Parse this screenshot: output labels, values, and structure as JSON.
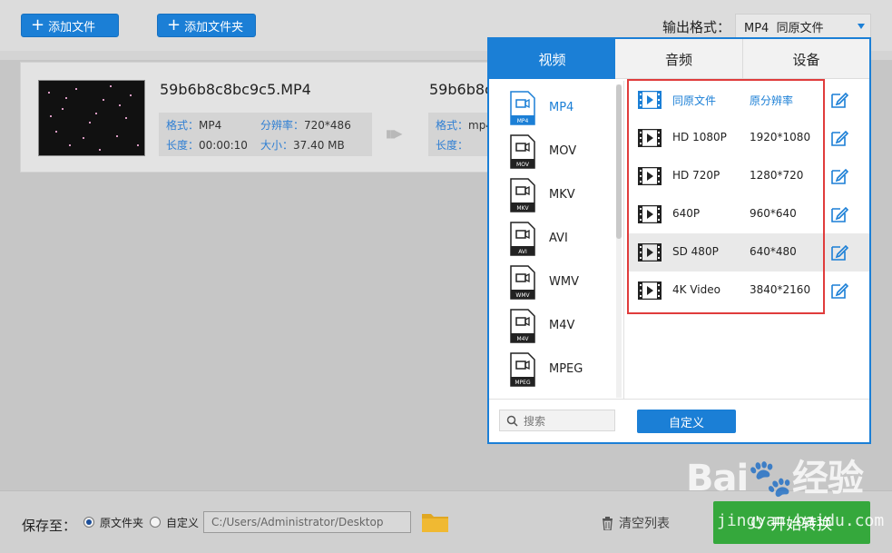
{
  "toolbar": {
    "add_file": "添加文件",
    "add_folder": "添加文件夹",
    "output_format_label": "输出格式：",
    "output_format_value": "MP4  同原文件"
  },
  "file": {
    "source_name": "59b6b8c8bc9c5.MP4",
    "target_name": "59b6b8c",
    "format_label": "格式：",
    "format_value": "MP4",
    "resolution_label": "分辨率：",
    "resolution_value": "720*486",
    "duration_label": "长度：",
    "duration_value": "00:00:10",
    "size_label": "大小：",
    "size_value": "37.40 MB",
    "target_format_label": "格式：",
    "target_format_value": "mp4",
    "target_duration_label": "长度："
  },
  "popup": {
    "tabs": [
      "视频",
      "音频",
      "设备"
    ],
    "formats": [
      "MP4",
      "MOV",
      "MKV",
      "AVI",
      "WMV",
      "M4V",
      "MPEG"
    ],
    "format_badges": [
      "MP4",
      "MOV",
      "MKV",
      "AVI",
      "WMV",
      "M4V",
      "MPEG"
    ],
    "presets": [
      {
        "name": "同原文件",
        "res": "原分辨率"
      },
      {
        "name": "HD 1080P",
        "res": "1920*1080"
      },
      {
        "name": "HD 720P",
        "res": "1280*720"
      },
      {
        "name": "640P",
        "res": "960*640"
      },
      {
        "name": "SD 480P",
        "res": "640*480"
      },
      {
        "name": "4K Video",
        "res": "3840*2160"
      }
    ],
    "search_placeholder": "搜索",
    "custom_button": "自定义"
  },
  "bottom": {
    "save_to": "保存至：",
    "option_source": "原文件夹",
    "option_custom": "自定义",
    "path": "C:/Users/Administrator/Desktop",
    "clear_list": "清空列表",
    "convert": "开始转换"
  },
  "watermark": {
    "brand": "Bai",
    "brand_cn": "经验",
    "url": "jingyan.baidu.com"
  },
  "colors": {
    "accent": "#1b7fd6",
    "highlight_box": "#e03c3c",
    "convert_green": "#35a83c"
  }
}
